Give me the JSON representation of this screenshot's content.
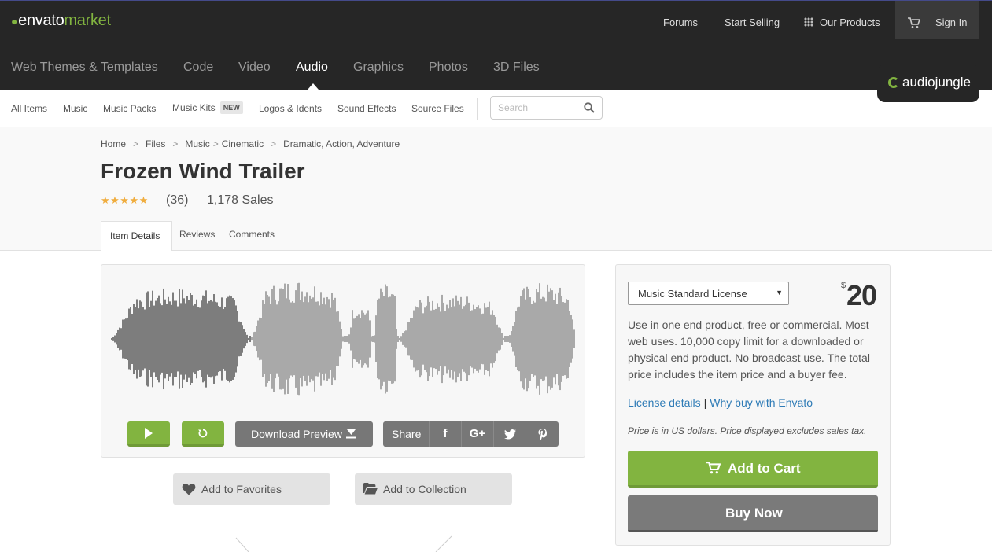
{
  "topbar": {
    "logo_part1": "envato",
    "logo_part2": "market",
    "forums": "Forums",
    "start_selling": "Start Selling",
    "our_products": "Our Products",
    "sign_in": "Sign In"
  },
  "categories": {
    "web_themes": "Web Themes & Templates",
    "code": "Code",
    "video": "Video",
    "audio": "Audio",
    "graphics": "Graphics",
    "photos": "Photos",
    "three_d": "3D Files",
    "active": "Audio",
    "badge": "audiojungle"
  },
  "subnav": {
    "all_items": "All Items",
    "music": "Music",
    "music_packs": "Music Packs",
    "music_kits": "Music Kits",
    "new_badge": "NEW",
    "logos_idents": "Logos & Idents",
    "sound_effects": "Sound Effects",
    "source_files": "Source Files",
    "search_placeholder": "Search"
  },
  "breadcrumb": [
    "Home",
    "Files",
    "Music",
    "Cinematic",
    "Dramatic, Action, Adventure"
  ],
  "item": {
    "title": "Frozen Wind Trailer",
    "stars": "★★★★★",
    "rating_count": "(36)",
    "sales": "1,178 Sales"
  },
  "tabs": {
    "item_details": "Item Details",
    "reviews": "Reviews",
    "comments": "Comments"
  },
  "player": {
    "progress": 0.3,
    "download_preview": "Download Preview",
    "share": "Share",
    "facebook": "f",
    "google_plus": "G+",
    "accent_color": "#82b440"
  },
  "actions": {
    "add_to_favorites": "Add to Favorites",
    "add_to_collection": "Add to Collection"
  },
  "purchase": {
    "license": "Music Standard License",
    "currency": "$",
    "price": "20",
    "description": "Use in one end product, free or commercial. Most web uses. 10,000 copy limit for a downloaded or physical end product. No broadcast use. The total price includes the item price and a buyer fee.",
    "license_details": "License details",
    "link_sep": "|",
    "why_buy": "Why buy with Envato",
    "price_note": "Price is in US dollars. Price displayed excludes sales tax.",
    "add_to_cart": "Add to Cart",
    "buy_now": "Buy Now"
  }
}
